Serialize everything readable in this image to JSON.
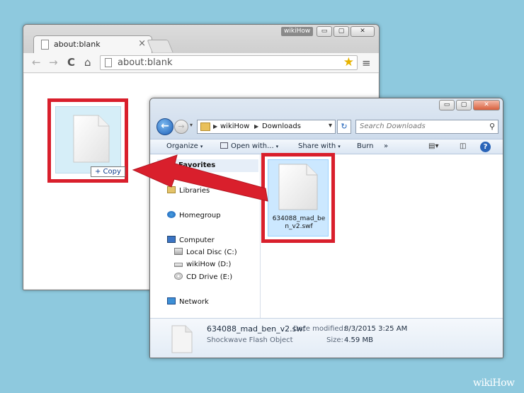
{
  "browser": {
    "tab_label": "about:blank",
    "tab_close": "×",
    "brand_badge": "wikiHow",
    "url": "about:blank",
    "window_buttons": {
      "min": "▭",
      "max": "▢",
      "close": "✕"
    },
    "nav": {
      "back": "←",
      "forward": "→",
      "reload": "C",
      "home": "⌂",
      "star": "★",
      "menu": "≡"
    }
  },
  "drag": {
    "copy_badge": "+ Copy"
  },
  "explorer": {
    "window_buttons": {
      "min": "▭",
      "max": "▢",
      "close": "✕"
    },
    "back_glyph": "←",
    "forward_glyph": "→",
    "history_glyph": "▾",
    "breadcrumb": [
      "wikiHow",
      "Downloads"
    ],
    "breadcrumb_sep": "▶",
    "address_drop": "▾",
    "refresh_glyph": "↻",
    "search_placeholder": "Search Downloads",
    "search_glyph": "⚲",
    "commands": {
      "organize": "Organize",
      "open_with": "Open with...",
      "share_with": "Share with",
      "burn": "Burn",
      "more": "»",
      "caret": "▾",
      "help": "?"
    },
    "nav_items": {
      "favorites": "Favorites",
      "libraries": "Libraries",
      "homegroup": "Homegroup",
      "computer": "Computer",
      "local_disc": "Local Disc (C:)",
      "wikihow_drive": "wikiHow (D:)",
      "cd_drive": "CD Drive (E:)",
      "network": "Network"
    },
    "file": {
      "name": "634088_mad_ben_v2.swf"
    },
    "details": {
      "name": "634088_mad_ben_v2.swf",
      "type": "Shockwave Flash Object",
      "modified_label": "Date modified:",
      "modified_value": "8/3/2015 3:25 AM",
      "size_label": "Size:",
      "size_value": "4.59 MB"
    }
  },
  "watermark": "wikiHow",
  "colors": {
    "highlight": "#d91f2c",
    "background": "#8ec9de"
  }
}
